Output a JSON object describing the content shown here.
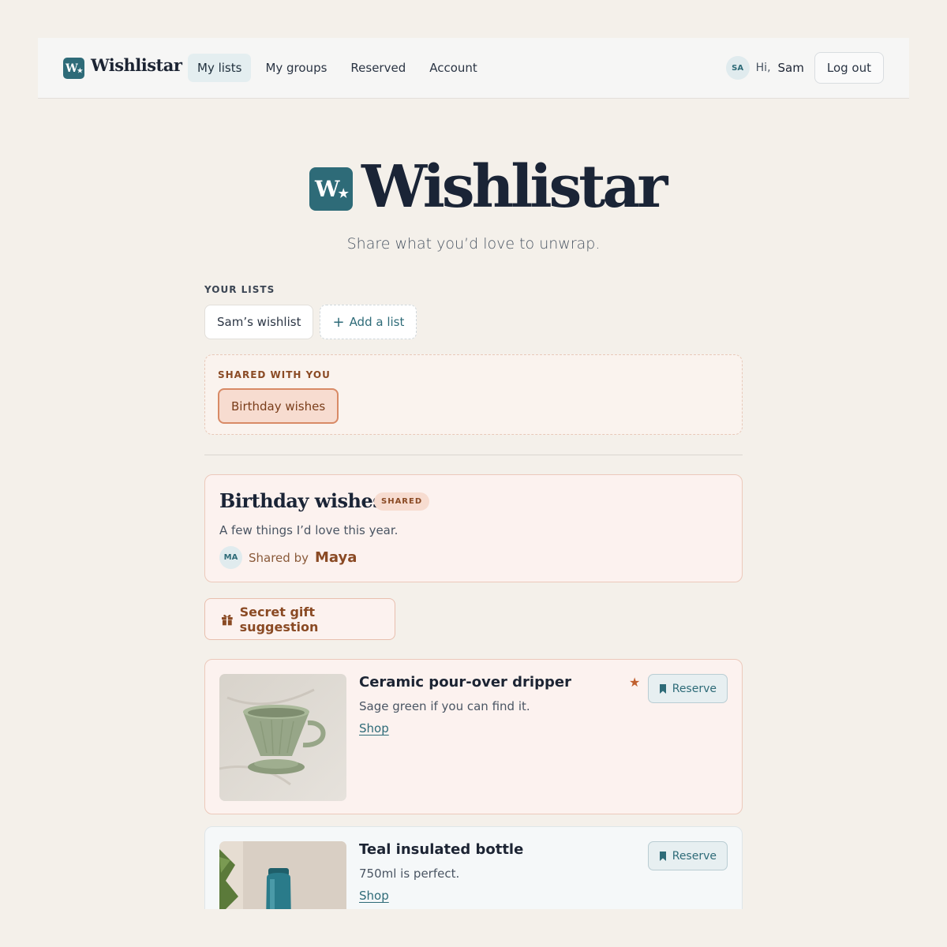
{
  "header": {
    "brand": "Wishlistar",
    "nav": [
      {
        "label": "My lists",
        "active": true
      },
      {
        "label": "My groups",
        "active": false
      },
      {
        "label": "Reserved",
        "active": false
      },
      {
        "label": "Account",
        "active": false
      }
    ],
    "user": {
      "initials": "SA",
      "greeting": "Hi,",
      "name": "Sam"
    },
    "logout_label": "Log out"
  },
  "hero": {
    "icon_letter": "W",
    "icon_star": "★",
    "title": "Wishlistar",
    "tagline": "Share what you’d love to unwrap."
  },
  "your_lists": {
    "label": "YOUR LISTS",
    "lists": [
      "Sam’s wishlist"
    ],
    "add_label": "Add a list",
    "add_icon": "+"
  },
  "shared_with_you": {
    "label": "SHARED WITH YOU",
    "lists": [
      "Birthday wishes"
    ]
  },
  "active_list": {
    "title": "Birthday wishes",
    "badge": "SHARED",
    "description": "A few things I’d love this year.",
    "owner_initials": "MA",
    "shared_by_label": "Shared by",
    "owner_name": "Maya"
  },
  "gift_suggestion_label": "Secret gift suggestion",
  "items": [
    {
      "title": "Ceramic pour-over dripper",
      "note": "Sage green if you can find it.",
      "link_label": "Shop",
      "starred": true,
      "reserve_label": "Reserve",
      "image": "sage-green-ceramic-dripper"
    },
    {
      "title": "Teal insulated bottle",
      "note": "750ml is perfect.",
      "link_label": "Shop",
      "starred": false,
      "reserve_label": "Reserve",
      "image": "teal-insulated-bottle"
    }
  ],
  "colors": {
    "brand": "#2e6b78",
    "accent_warm": "#8a4a24",
    "background": "#f4f0ea"
  }
}
